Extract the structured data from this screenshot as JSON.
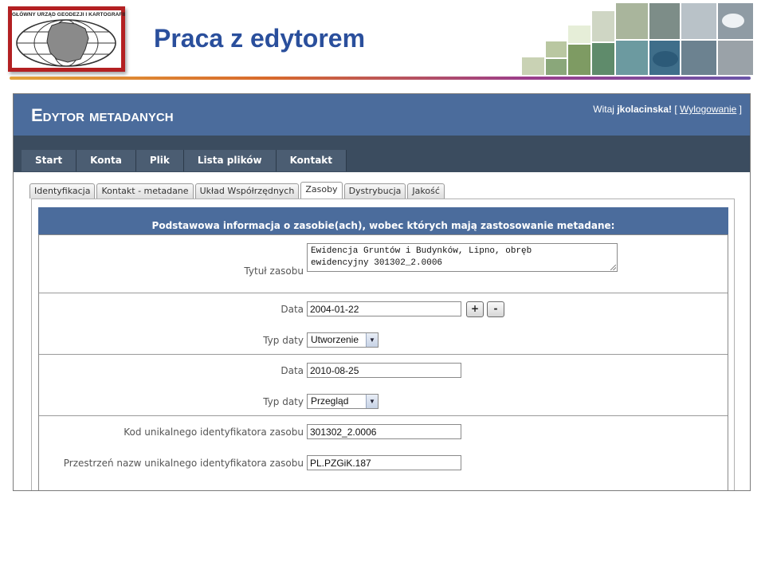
{
  "slide": {
    "title": "Praca z edytorem",
    "logo_text": "GŁÓWNY URZĄD GEODEZJI I KARTOGRAFII"
  },
  "app": {
    "title": "Edytor metadanych",
    "welcome_prefix": "Witaj",
    "username": "jkolacinska!",
    "bracket_open": "[",
    "logout_label": "Wylogowanie",
    "bracket_close": "]"
  },
  "nav": [
    {
      "label": "Start"
    },
    {
      "label": "Konta"
    },
    {
      "label": "Plik"
    },
    {
      "label": "Lista plików"
    },
    {
      "label": "Kontakt"
    }
  ],
  "tabs": [
    {
      "label": "Identyfikacja",
      "active": false
    },
    {
      "label": "Kontakt - metadane",
      "active": false
    },
    {
      "label": "Układ Współrzędnych",
      "active": false
    },
    {
      "label": "Zasoby",
      "active": true
    },
    {
      "label": "Dystrybucja",
      "active": false
    },
    {
      "label": "Jakość",
      "active": false
    }
  ],
  "section": {
    "heading": "Podstawowa informacja o zasobie(ach), wobec których mają zastosowanie metadane:"
  },
  "form": {
    "title_label": "Tytuł zasobu",
    "title_value": "Ewidencja Gruntów i Budynków, Lipno, obręb\newidencyjny 301302_2.0006",
    "date1_label": "Data",
    "date1_value": "2004-01-22",
    "add_label": "+",
    "remove_label": "-",
    "date_type1_label": "Typ daty",
    "date_type1_value": "Utworzenie",
    "date2_label": "Data",
    "date2_value": "2010-08-25",
    "date_type2_label": "Typ daty",
    "date_type2_value": "Przegląd",
    "code_label": "Kod unikalnego identyfikatora zasobu",
    "code_value": "301302_2.0006",
    "namespace_label": "Przestrzeń nazw unikalnego identyfikatora zasobu",
    "namespace_value": "PL.PZGiK.187"
  },
  "colors": {
    "slide_title": "#2a4f9c",
    "app_header": "#4b6c9c",
    "nav_bar": "#3b4c5f",
    "logo_red": "#b32022"
  }
}
